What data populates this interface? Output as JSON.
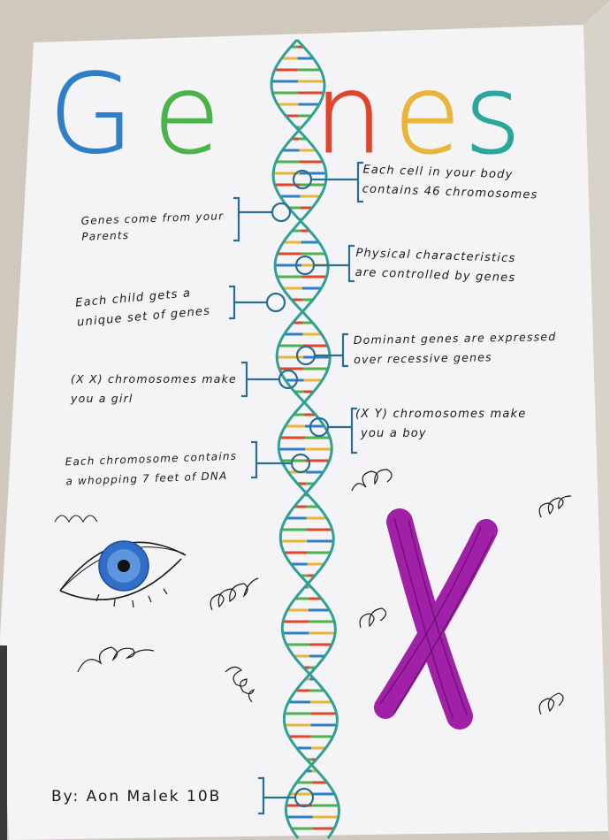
{
  "poster": {
    "title_letters": [
      {
        "char": "G",
        "color": "#2f7fc7"
      },
      {
        "char": "e",
        "color": "#4cb24a"
      },
      {
        "char": "n",
        "color": "#e0452b"
      },
      {
        "char": "e",
        "color": "#e8b53a"
      },
      {
        "char": "s",
        "color": "#2aa79b"
      }
    ],
    "notes_right": [
      {
        "lines": [
          "Each cell in your body",
          "contains 46 chromosomes"
        ]
      },
      {
        "lines": [
          "Physical characteristics",
          "are controlled by genes"
        ]
      },
      {
        "lines": [
          "Dominant genes are expressed",
          "over recessive genes"
        ]
      },
      {
        "lines": [
          "(X Y) chromosomes make",
          "you a boy"
        ]
      }
    ],
    "notes_left": [
      {
        "lines": [
          "Genes come from your",
          "Parents"
        ]
      },
      {
        "lines": [
          "Each child gets a",
          "unique set of genes"
        ]
      },
      {
        "lines": [
          "(X X) chromosomes make",
          "you a girl"
        ]
      },
      {
        "lines": [
          "Each chromosome contains",
          "a whopping 7 feet of DNA"
        ]
      }
    ],
    "signature": "By: Aon Malek 10B",
    "colors": {
      "paper": "#f4f4f6",
      "backbone": "#2fa096",
      "bracket": "#2a6f8f",
      "ink": "#1a1a1a",
      "chromosome": "#a020a8",
      "iris": "#2f6fc7",
      "rungs": [
        "#e0452b",
        "#2f7fc7",
        "#4cb24a",
        "#e8b53a"
      ]
    }
  }
}
